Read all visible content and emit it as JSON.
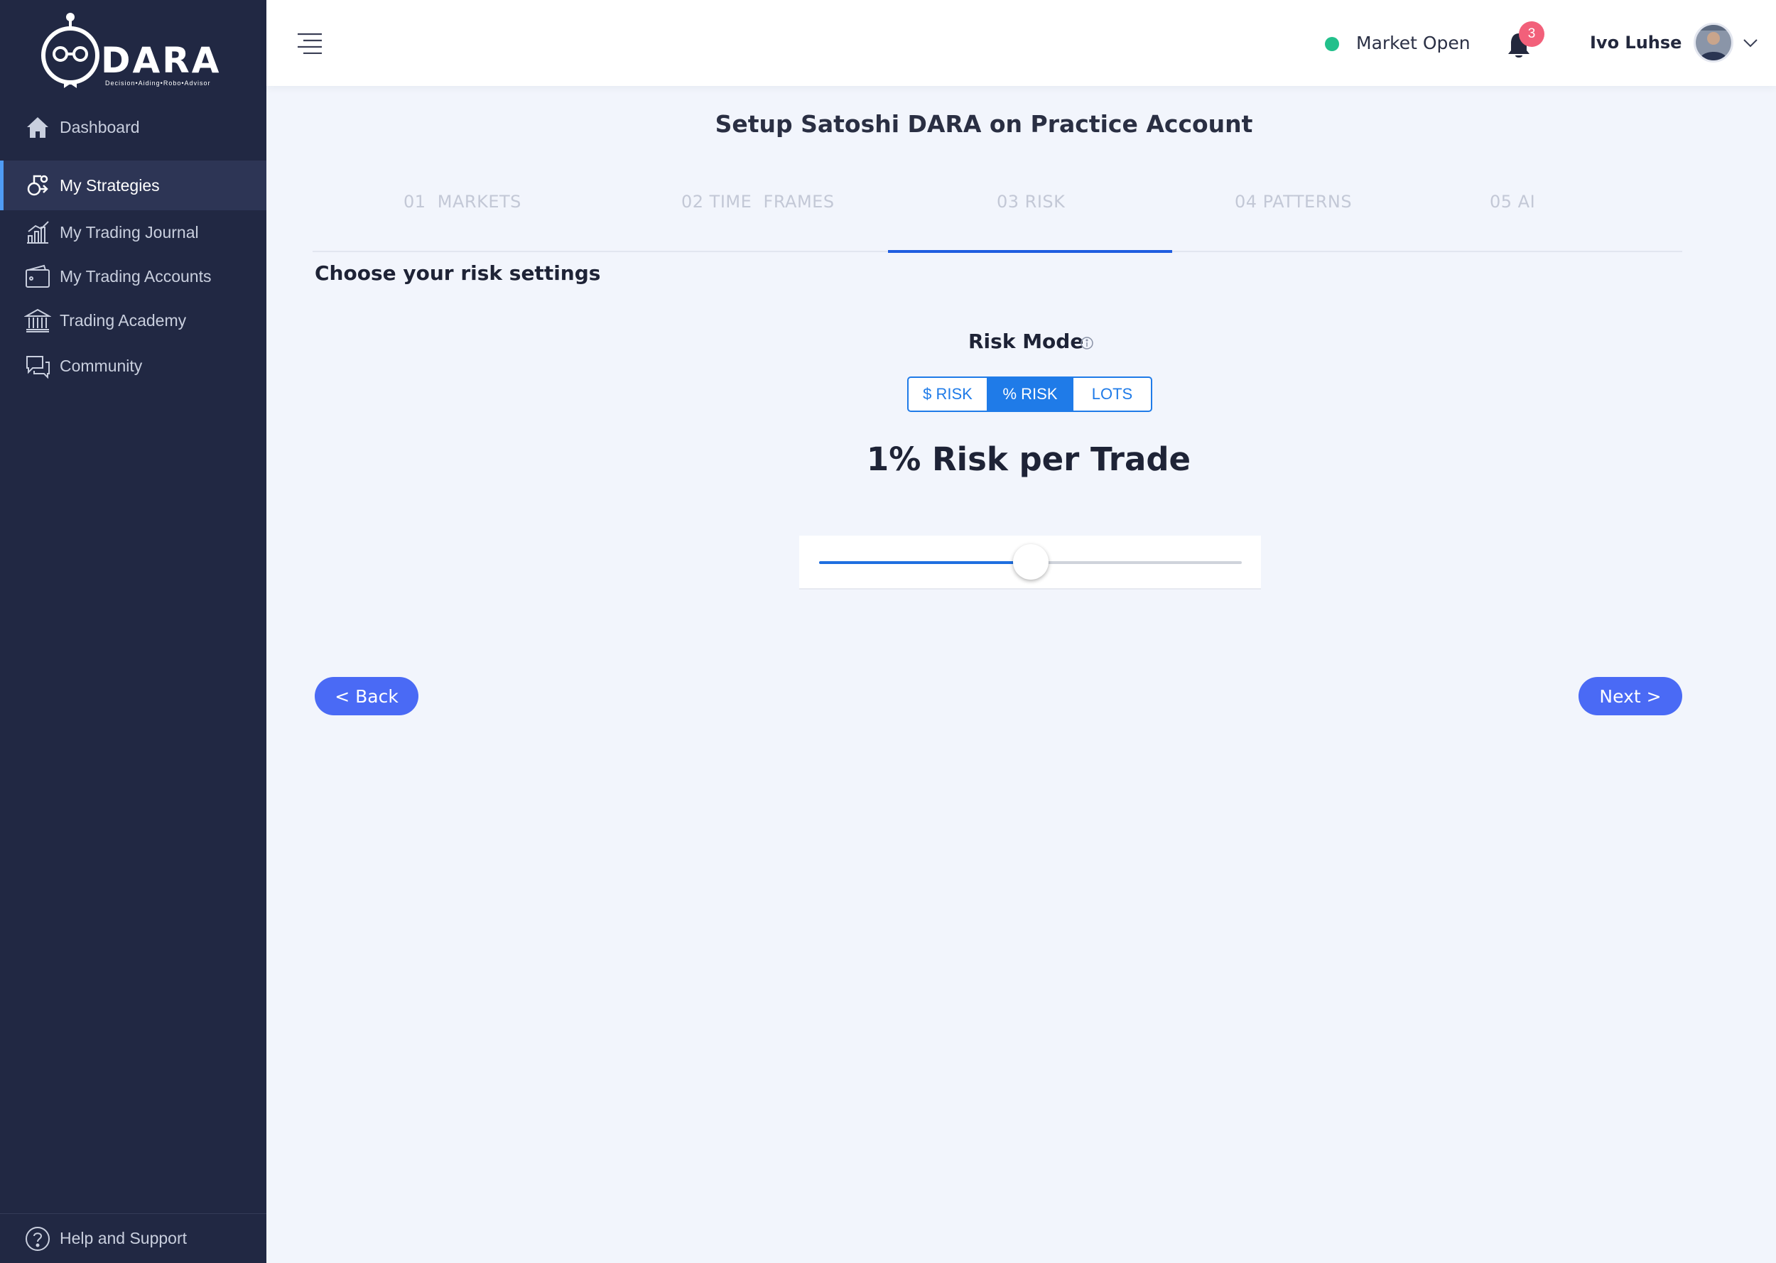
{
  "brand": {
    "name": "DARA",
    "tagline": "Decision•Aiding•Robo•Advisor"
  },
  "sidebar": {
    "items": [
      {
        "label": "Dashboard",
        "icon": "home-icon"
      },
      {
        "label": "My Strategies",
        "icon": "strategies-icon",
        "active": true
      },
      {
        "label": "My Trading Journal",
        "icon": "chart-icon"
      },
      {
        "label": "My Trading Accounts",
        "icon": "wallet-icon"
      },
      {
        "label": "Trading Academy",
        "icon": "bank-icon"
      },
      {
        "label": "Community",
        "icon": "chat-icon"
      }
    ],
    "help": {
      "label": "Help and Support",
      "icon": "question-icon"
    }
  },
  "header": {
    "market_status": "Market Open",
    "market_status_color": "#22c08b",
    "notifications_count": "3",
    "user_name": "Ivo Luhse"
  },
  "main": {
    "title": "Setup Satoshi DARA on Practice Account",
    "tabs": [
      {
        "label": "01  MARKETS"
      },
      {
        "label": "02 TIME  FRAMES"
      },
      {
        "label": "03 RISK",
        "active": true
      },
      {
        "label": "04 PATTERNS"
      },
      {
        "label": "05 AI"
      }
    ],
    "section_title": "Choose your risk settings",
    "risk_mode": {
      "label": "Risk Mode",
      "options": [
        "$ RISK",
        "% RISK",
        "LOTS"
      ],
      "selected": "% RISK"
    },
    "risk_value_text": "1% Risk per Trade",
    "slider": {
      "value": 0.5
    },
    "back_label": "< Back",
    "next_label": "Next >"
  },
  "colors": {
    "sidebar_bg": "#212843",
    "accent": "#1f7be8",
    "button": "#4a6af5",
    "badge": "#f2607a"
  }
}
